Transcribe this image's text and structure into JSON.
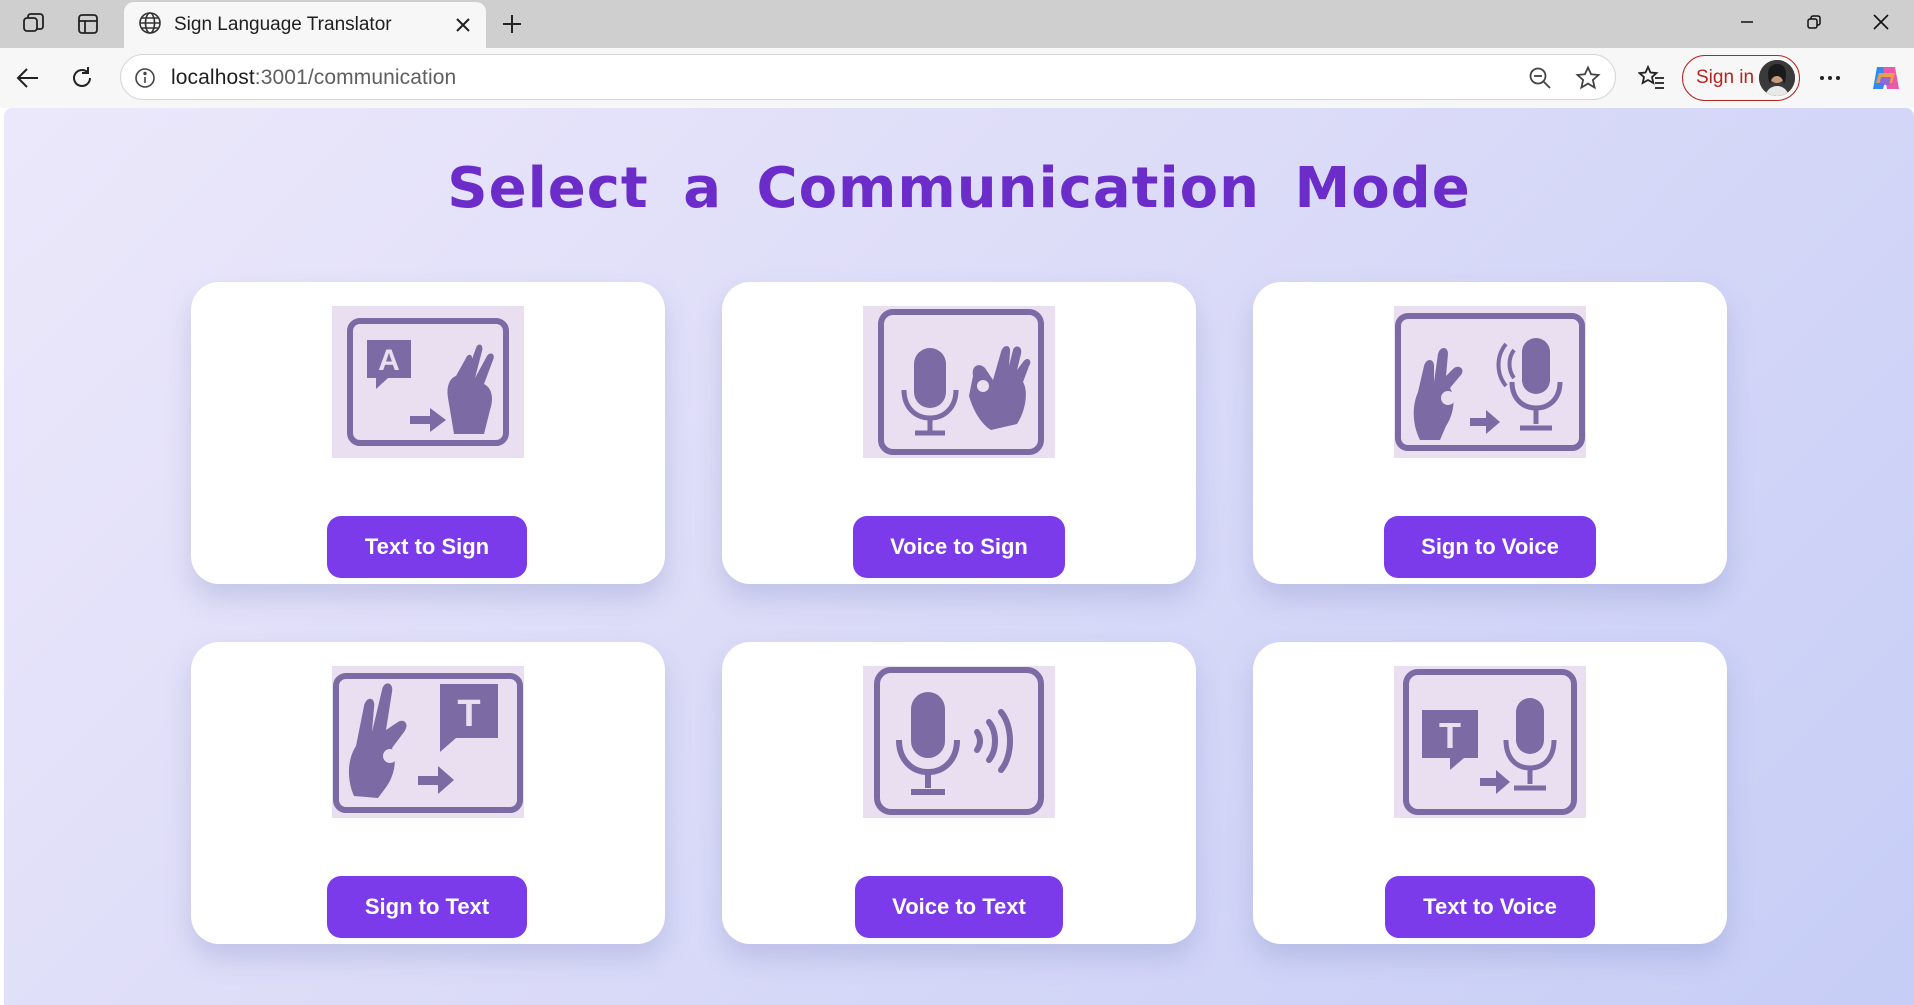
{
  "browser": {
    "tab_title": "Sign Language Translator",
    "url_host": "localhost",
    "url_path": ":3001/communication",
    "signin_label": "Sign in",
    "accent_color": "#b3261e"
  },
  "page": {
    "title": "Select a Communication Mode",
    "title_color": "#6b2cc9",
    "button_color": "#7b3bea",
    "cards": [
      {
        "label": "Text to Sign",
        "icon": "text-to-sign-icon"
      },
      {
        "label": "Voice to Sign",
        "icon": "voice-to-sign-icon"
      },
      {
        "label": "Sign to Voice",
        "icon": "sign-to-voice-icon"
      },
      {
        "label": "Sign to Text",
        "icon": "sign-to-text-icon"
      },
      {
        "label": "Voice to Text",
        "icon": "voice-to-text-icon"
      },
      {
        "label": "Text to Voice",
        "icon": "text-to-voice-icon"
      }
    ]
  }
}
